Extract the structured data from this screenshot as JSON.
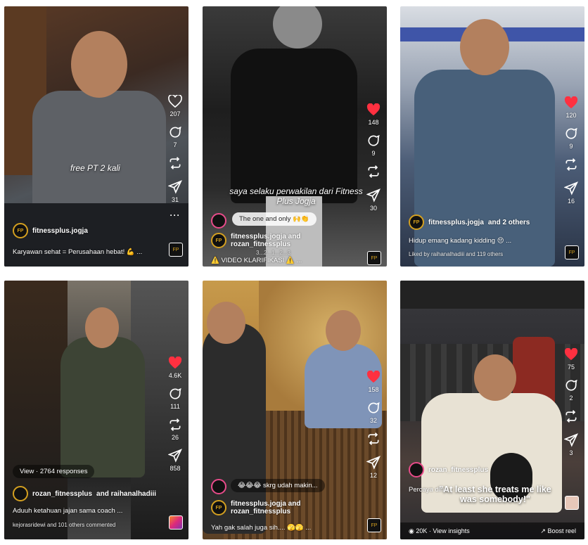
{
  "tiles": [
    {
      "overlay_text": "free PT 2 kali",
      "counts": {
        "likes": "207",
        "comments": "7",
        "reposts": "",
        "shares": "31"
      },
      "account": "fitnessplus.jogja",
      "description": "Karyawan sehat = Perusahaan hebat! 💪 ..."
    },
    {
      "overlay_text": "saya selaku perwakilan dari Fitness Plus Jogja",
      "counts": {
        "likes": "148",
        "comments": "9",
        "reposts": "",
        "shares": "30"
      },
      "pill": "The one and only 🙌👏",
      "account_line1": "fitnessplus.jogja and",
      "account_line2": "rozan_fitnessplus",
      "description": "⚠️ VIDEO KLARIFIKASI ⚠️ ...",
      "badge_text": "3...2...1...2...3"
    },
    {
      "counts": {
        "likes": "120",
        "comments": "9",
        "reposts": "",
        "shares": "16"
      },
      "account": "fitnessplus.jogja",
      "account_suffix": "and 2 others",
      "description": "Hidup emang kadang kidding 😔 ...",
      "liked_by": "Liked by raihanalhadiii and 119 others"
    },
    {
      "counts": {
        "likes": "4.6K",
        "comments": "111",
        "reposts": "26",
        "shares": "858"
      },
      "view_pill": "View · 2764 responses",
      "account": "rozan_fitnessplus",
      "account_suffix": "and raihanalhadiii",
      "description": "Aduuh ketahuan jajan sama coach ...",
      "commented": "kejorasridewi and 101 others commented"
    },
    {
      "counts": {
        "likes": "158",
        "comments": "32",
        "reposts": "",
        "shares": "12"
      },
      "pill": "😂😂😂 skrg udah makin...",
      "account_line1": "fitnessplus.jogja and",
      "account_line2": "rozan_fitnessplus",
      "description": "Yah gak salah juga sih.... 🫣🫣 ..."
    },
    {
      "overlay_text": "\"At least she treats me like was somebody!\"",
      "counts": {
        "likes": "75",
        "comments": "2",
        "reposts": "",
        "shares": "3"
      },
      "account": "rozan_fitnessplus",
      "description": "Percaya diri ...",
      "insights": "20K · View insights",
      "boost": "Boost reel"
    }
  ],
  "colors": {
    "heart_red": "#ff3040",
    "brand_gold": "#d4a020"
  },
  "icons": [
    "heart-icon",
    "comment-icon",
    "repost-icon",
    "share-icon",
    "more-icon"
  ]
}
